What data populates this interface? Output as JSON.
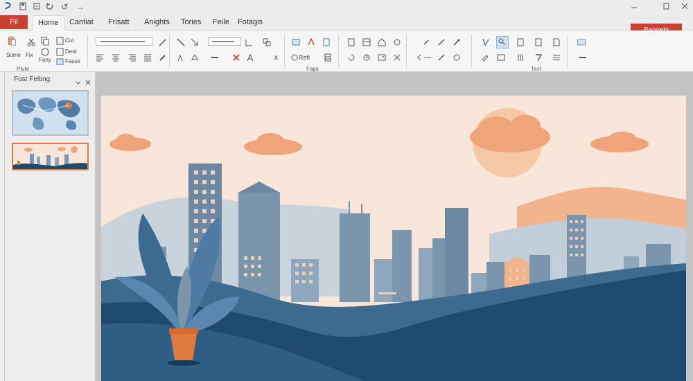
{
  "quick_access": {
    "undo_symbol": "↺",
    "redo_symbol": "→",
    "icons": [
      "save-icon",
      "autosave-icon",
      "undo-icon",
      "redo-icon"
    ]
  },
  "window_controls": [
    "minimize-icon",
    "restore-icon",
    "close-icon"
  ],
  "tabs": {
    "file": "Fil",
    "items": [
      "Home",
      "Cantiat",
      "Frisatt",
      "Anights",
      "Tories",
      "Feile",
      "Fotagis"
    ],
    "active": "Home",
    "share_button": "Pangets"
  },
  "ribbon": {
    "clipboard": {
      "paste": "Some",
      "cut": "Fix",
      "copy": "Fany",
      "cut_label": "Cut",
      "copy_label": "Dent",
      "format_label": "Fasse"
    },
    "font": {
      "size_label": "x"
    },
    "paragraph": {
      "radio_label": "Refi"
    },
    "group_labels": [
      "Plute",
      "Faps",
      "Text"
    ]
  },
  "slides_pane": {
    "title": "Fost Felting"
  },
  "slides": [
    {
      "theme": "world-map",
      "selected": false
    },
    {
      "theme": "city-skyline",
      "selected": true
    }
  ],
  "colors": {
    "accent": "#c9412f",
    "navy": "#1f4a70",
    "sky": "#f8e6da",
    "cloud": "#f0a47a",
    "steel": "#7b95ad",
    "pot": "#e07b3f"
  }
}
